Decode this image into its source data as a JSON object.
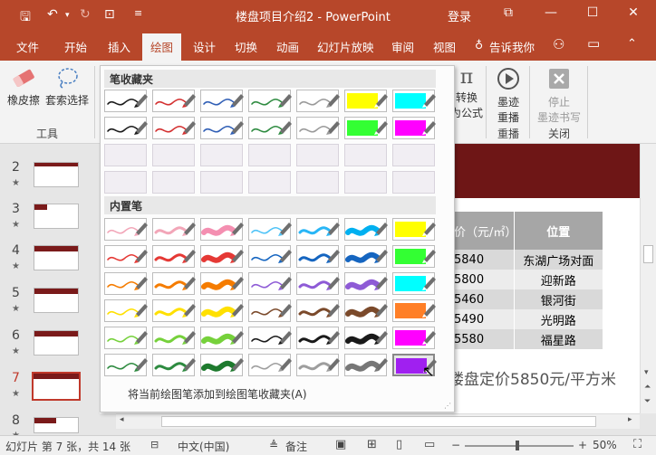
{
  "window": {
    "title": "楼盘项目介绍2  -  PowerPoint",
    "login": "登录"
  },
  "tabs": [
    "文件",
    "开始",
    "插入",
    "绘图",
    "设计",
    "切换",
    "动画",
    "幻灯片放映",
    "审阅",
    "视图",
    "告诉我你"
  ],
  "active_tab": "绘图",
  "ribbon": {
    "eraser": "橡皮擦",
    "lasso": "套索选择",
    "tools_group": "工具",
    "convert_line1": "转换",
    "convert_line2": "为公式",
    "replay_line1": "墨迹",
    "replay_line2": "重播",
    "stop_line1": "停止",
    "stop_line2": "墨迹书写",
    "replay_group": "重播",
    "close_group": "关闭"
  },
  "pen_gallery": {
    "favorites_title": "笔收藏夹",
    "builtin_title": "内置笔",
    "footer": "将当前绘图笔添加到绘图笔收藏夹(A)",
    "favorite_rows": [
      [
        "#1a1a1a",
        "#d32f2f",
        "#2f5eb5",
        "#2e8b40",
        "#999999",
        "#ffff00",
        "#00ffff"
      ],
      [
        "#1a1a1a",
        "#d32f2f",
        "#2f5eb5",
        "#2e8b40",
        "#999999",
        "#33ff33",
        "#ff00ff"
      ]
    ],
    "builtin_rows": [
      [
        "#f2a6b8",
        "#f2a6b8",
        "#f48fb1",
        "#4fc3f7",
        "#29b6f6",
        "#00b0f0",
        "#ffff00"
      ],
      [
        "#e53935",
        "#e53935",
        "#e53935",
        "#1565c0",
        "#1565c0",
        "#1565c0",
        "#33ff33"
      ],
      [
        "#f57c00",
        "#f57c00",
        "#f57c00",
        "#8e5bd6",
        "#8e5bd6",
        "#8e5bd6",
        "#00ffff"
      ],
      [
        "#ffe000",
        "#ffe000",
        "#ffe000",
        "#7b4a2b",
        "#7b4a2b",
        "#7b4a2b",
        "#ff7f27"
      ],
      [
        "#76d13b",
        "#76d13b",
        "#76d13b",
        "#1a1a1a",
        "#1a1a1a",
        "#1a1a1a",
        "#ff00ff"
      ],
      [
        "#2e8b40",
        "#2e8b40",
        "#1e7a2e",
        "#9e9e9e",
        "#9e9e9e",
        "#777777",
        "#a020f0"
      ]
    ]
  },
  "slides": {
    "numbers": [
      "2",
      "3",
      "4",
      "5",
      "6",
      "7",
      "8"
    ],
    "star": "★",
    "selected": "7"
  },
  "slide_content": {
    "header_cells": [
      "价（元/㎡）",
      "位置"
    ],
    "rows": [
      [
        "5840",
        "东湖广场对面"
      ],
      [
        "5800",
        "迎新路"
      ],
      [
        "5460",
        "银河街"
      ],
      [
        "5490",
        "光明路"
      ],
      [
        "5580",
        "福星路"
      ]
    ],
    "summary": "楼盘定价5850元/平方米"
  },
  "status": {
    "slide_info": "幻灯片 第 7 张，共 14 张",
    "language": "中文(中国)",
    "notes": "备注",
    "zoom": "50%"
  }
}
